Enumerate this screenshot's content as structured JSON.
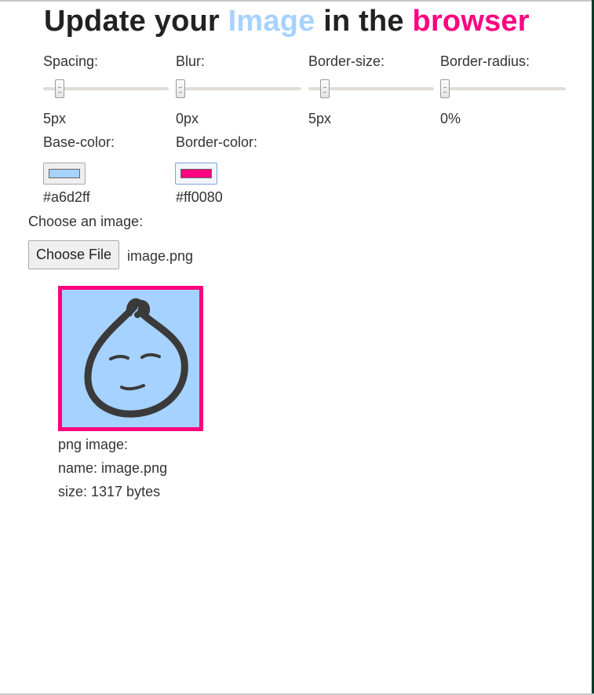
{
  "title": {
    "prefix": "Update your ",
    "highlight1": "Image",
    "middle": " in the ",
    "highlight2": "browser"
  },
  "controls": {
    "spacing": {
      "label": "Spacing:",
      "value": "5px",
      "fraction": 0.1
    },
    "blur": {
      "label": "Blur:",
      "value": "0px",
      "fraction": 0.0
    },
    "border_size": {
      "label": "Border-size:",
      "value": "5px",
      "fraction": 0.1
    },
    "border_radius": {
      "label": "Border-radius:",
      "value": "0%",
      "fraction": 0.0
    },
    "base_color": {
      "label": "Base-color:",
      "value": "#a6d2ff"
    },
    "border_color": {
      "label": "Border-color:",
      "value": "#ff0080"
    }
  },
  "file": {
    "label": "Choose an image:",
    "button": "Choose File",
    "filename": "image.png"
  },
  "image_info": {
    "type_line": "png image:",
    "name_line": "name: image.png",
    "size_line": "size: 1317 bytes"
  },
  "colors": {
    "highlight_blue": "#a6d2ff",
    "highlight_pink": "#ff0080"
  },
  "preview": {
    "icon": "drop-face-icon"
  }
}
